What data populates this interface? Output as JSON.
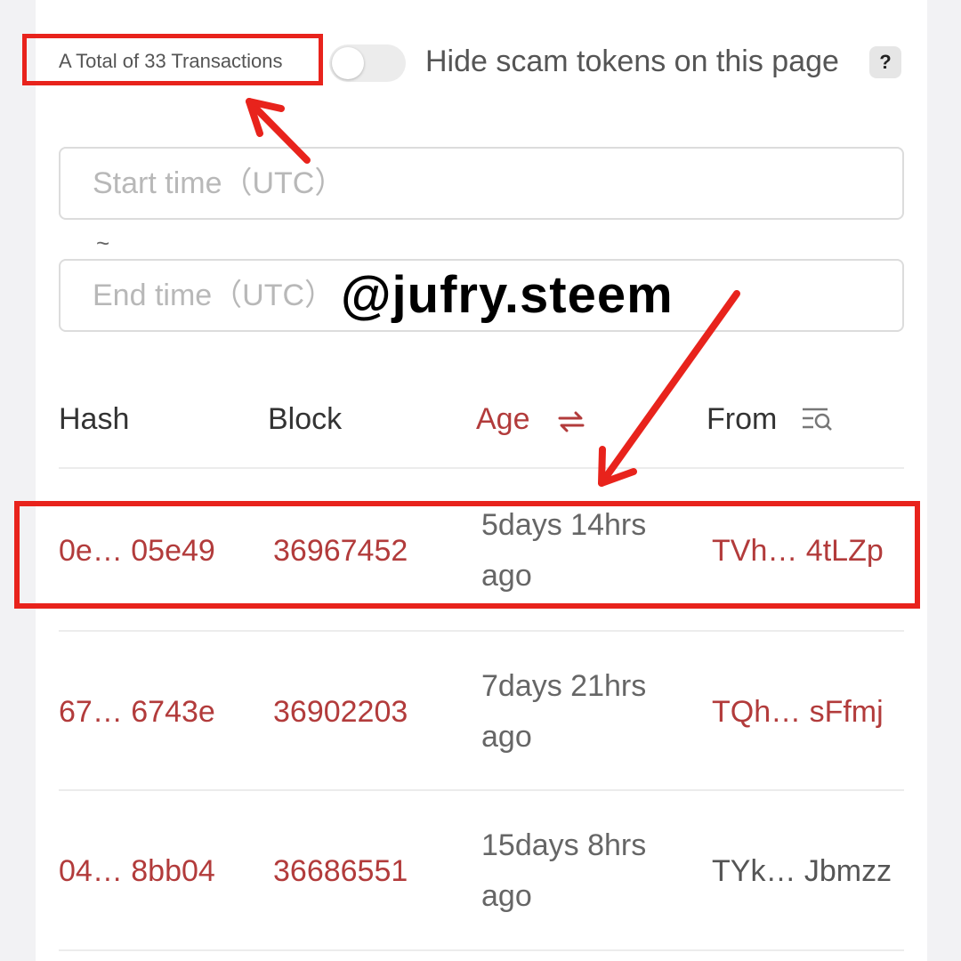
{
  "summary": {
    "total_label": "A Total of 33 Transactions",
    "hide_scam_label": "Hide scam tokens on this page",
    "help_icon": "?",
    "hide_scam_enabled": false
  },
  "filters": {
    "start_placeholder": "Start time（UTC）",
    "separator": "~",
    "end_placeholder": "End time（UTC）"
  },
  "watermark": "@jufry.steem",
  "table": {
    "columns": [
      "Hash",
      "Block",
      "Age",
      "From"
    ],
    "rows": [
      {
        "hash": "0e… 05e49",
        "block": "36967452",
        "age_line1": "5days 14hrs",
        "age_line2": "ago",
        "from": "TVh… 4tLZp"
      },
      {
        "hash": "67… 6743e",
        "block": "36902203",
        "age_line1": "7days 21hrs",
        "age_line2": "ago",
        "from": "TQh…  sFfmj"
      },
      {
        "hash": "04… 8bb04",
        "block": "36686551",
        "age_line1": "15days 8hrs",
        "age_line2": "ago",
        "from": "TYk… Jbmzz"
      }
    ]
  },
  "icons": {
    "sort": "swap-arrows-icon",
    "filter": "filter-search-icon",
    "annotation": "red-arrow-icon"
  },
  "colors": {
    "link": "#b23b3b",
    "annotation": "#e8231c"
  }
}
